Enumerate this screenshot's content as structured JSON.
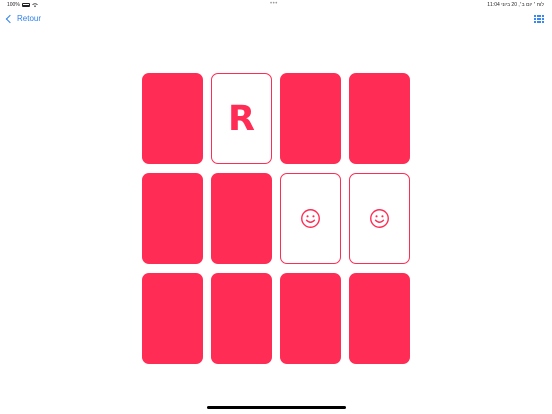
{
  "status_bar": {
    "battery": "100%",
    "dots": "•••",
    "right_text": "11:04 לוח ׳ יום ב׳, 20 ביוני"
  },
  "nav": {
    "back_label": "Retour",
    "back_icon": "chevron-left-icon",
    "grid_icon": "grid-icon"
  },
  "board": {
    "rows": 3,
    "columns": 4,
    "cards": [
      {
        "state": "down",
        "content": ""
      },
      {
        "state": "up",
        "content": "R"
      },
      {
        "state": "down",
        "content": ""
      },
      {
        "state": "down",
        "content": ""
      },
      {
        "state": "down",
        "content": ""
      },
      {
        "state": "down",
        "content": ""
      },
      {
        "state": "up",
        "content": "smiley"
      },
      {
        "state": "up",
        "content": "smiley"
      },
      {
        "state": "down",
        "content": ""
      },
      {
        "state": "down",
        "content": ""
      },
      {
        "state": "down",
        "content": ""
      },
      {
        "state": "down",
        "content": ""
      }
    ]
  },
  "colors": {
    "card": "#ff2d55",
    "accent": "#2f80ed"
  }
}
